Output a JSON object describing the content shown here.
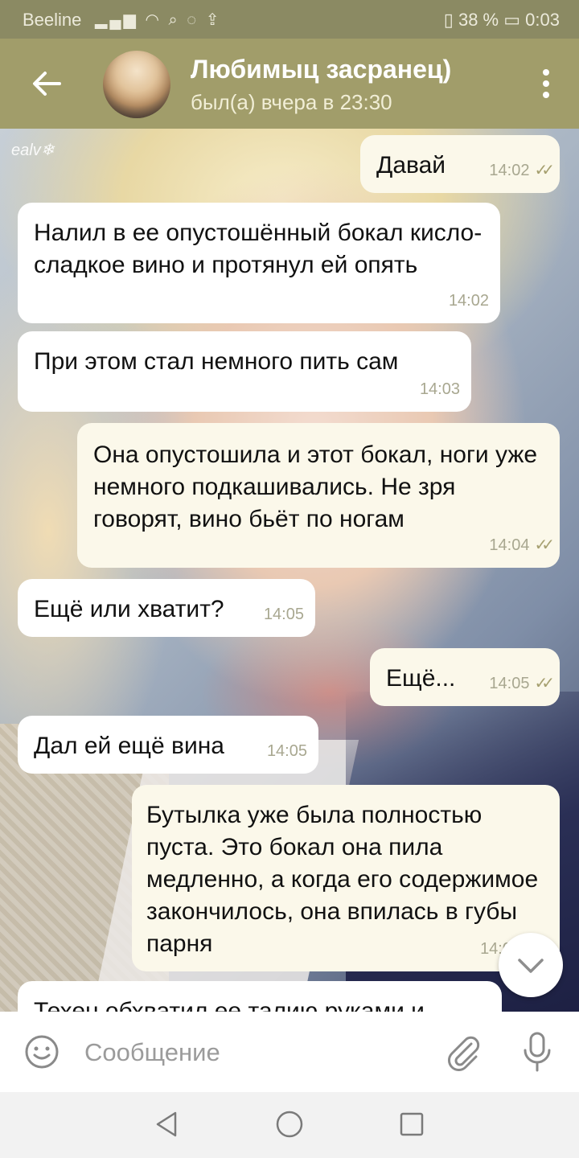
{
  "status_bar": {
    "carrier": "Beeline",
    "icons": [
      "signal-icon",
      "wifi-icon",
      "search-icon",
      "whatsapp-icon",
      "upload-icon"
    ],
    "battery": "38 %",
    "time": "0:03"
  },
  "header": {
    "contact_name": "Любимыц засранец)",
    "last_seen": "был(а) вчера в 23:30"
  },
  "messages": [
    {
      "direction": "out",
      "text": "Давай",
      "time": "14:02",
      "read": true
    },
    {
      "direction": "in",
      "text": "Налил в ее опустошённый бокал кисло-сладкое вино и протянул ей опять",
      "time": "14:02"
    },
    {
      "direction": "in",
      "text": "При этом стал немного пить сам",
      "time": "14:03"
    },
    {
      "direction": "out",
      "text": "Она опустошила и этот бокал, ноги уже немного подкашивались. Не зря говорят, вино бьёт по ногам",
      "time": "14:04",
      "read": true
    },
    {
      "direction": "in",
      "text": "Ещё или хватит?",
      "time": "14:05"
    },
    {
      "direction": "out",
      "text": "Ещё...",
      "time": "14:05",
      "read": true
    },
    {
      "direction": "in",
      "text": "Дал ей ещё вина",
      "time": "14:05"
    },
    {
      "direction": "out",
      "text": "Бутылка уже была полностью пуста. Это бокал она пила медленно, а когда его содержимое закончилось, она впилась в губы парня",
      "time": "14:0"
    },
    {
      "direction": "in",
      "text": "Техен обхватил ее талию руками и"
    }
  ],
  "wallpaper_signature": "ealv❄",
  "input": {
    "placeholder": "Сообщение"
  },
  "colors": {
    "header": "#a19d6a",
    "status_bar": "#8b8a63",
    "outgoing_bubble": "#fbf8ea",
    "incoming_bubble": "#ffffff",
    "read_check": "#a6a070"
  }
}
